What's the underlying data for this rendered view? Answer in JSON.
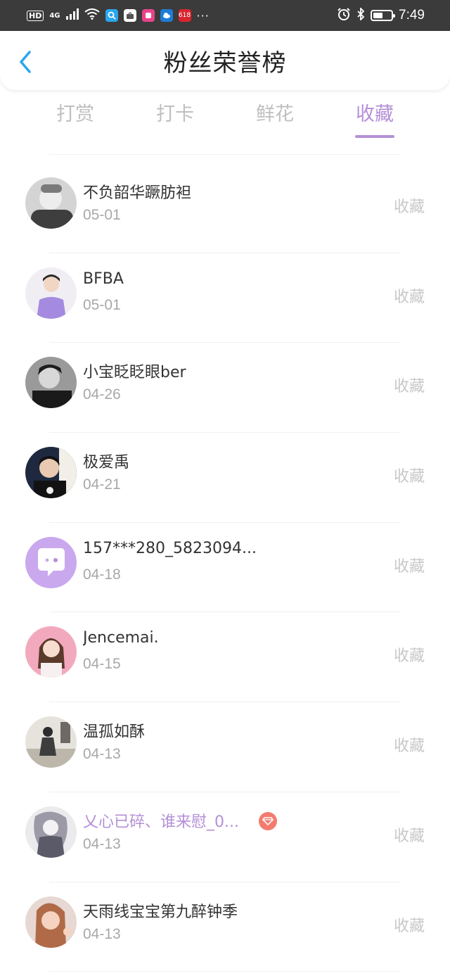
{
  "status_bar": {
    "hd": "HD",
    "network": "4G",
    "apps": [
      {
        "icon": "search-app-icon",
        "text": "",
        "color": "#2aa6ef"
      },
      {
        "icon": "huawei-bag-icon",
        "text": "",
        "color": "#ffffff"
      },
      {
        "icon": "shopping-app-icon",
        "text": "",
        "color": "#e8438a"
      },
      {
        "icon": "weather-app-icon",
        "text": "",
        "color": "#1f7bd6"
      },
      {
        "icon": "tmall-618-icon",
        "text": "618",
        "color": "#d9252f"
      }
    ],
    "more": "···",
    "time": "7:49",
    "battery_level": 0.55
  },
  "header": {
    "title": "粉丝荣誉榜",
    "back_icon": "chevron-left-icon",
    "accent": "#2aa6ef"
  },
  "tabs": [
    {
      "label": "打赏",
      "active": false
    },
    {
      "label": "打卡",
      "active": false
    },
    {
      "label": "鲜花",
      "active": false
    },
    {
      "label": "收藏",
      "active": true
    }
  ],
  "accent_color": "#b48fd8",
  "fans": [
    {
      "name": "不负韶华蹶肪袒",
      "date": "05-01",
      "type": "收藏",
      "avatar": "avatar-gray-boy",
      "vip": false
    },
    {
      "name": "BFBA",
      "date": "05-01",
      "type": "收藏",
      "avatar": "avatar-purple-shirt",
      "vip": false
    },
    {
      "name": "小宝眨眨眼ber",
      "date": "04-26",
      "type": "收藏",
      "avatar": "avatar-dark-portrait",
      "vip": false
    },
    {
      "name": "极爱禹",
      "date": "04-21",
      "type": "收藏",
      "avatar": "avatar-black-tee",
      "vip": false
    },
    {
      "name": "157***280_5823094...",
      "date": "04-18",
      "type": "收藏",
      "avatar": "avatar-default-chat",
      "vip": false
    },
    {
      "name": "Jencemai.",
      "date": "04-15",
      "type": "收藏",
      "avatar": "avatar-pink-girl",
      "vip": false
    },
    {
      "name": "温孤如酥",
      "date": "04-13",
      "type": "收藏",
      "avatar": "avatar-street-photo",
      "vip": false
    },
    {
      "name": "乂心已碎、谁来慰_0...",
      "date": "04-13",
      "type": "收藏",
      "avatar": "avatar-sketch-art",
      "vip": true
    },
    {
      "name": "天雨线宝宝第九醉钟季",
      "date": "04-13",
      "type": "收藏",
      "avatar": "avatar-orange-girl",
      "vip": false
    }
  ]
}
